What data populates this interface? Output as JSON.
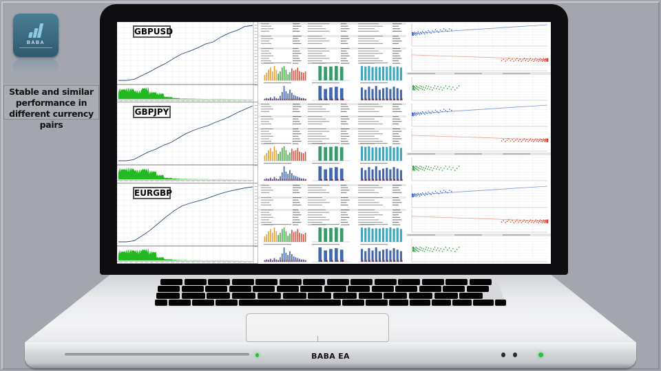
{
  "branding": {
    "logo_text": "BABA",
    "tagline": "Stable and similar performance in different currency pairs",
    "laptop_label": "BABA EA"
  },
  "colors": {
    "background": "#a3a6ae",
    "logo_bg": "#3b6a82",
    "equity_line": "#2c4a7a",
    "deposit_load": "#22b922",
    "bar_orange": "#e8a43a",
    "bar_green": "#4daa4d",
    "bar_red": "#d2594a",
    "bar_teal_green": "#3a9a6a",
    "bar_cyan": "#3aa7c0",
    "bar_blue": "#4466aa",
    "bar_darkred": "#9a2a2a",
    "scatter_blue": "#3b63c4",
    "scatter_red": "#d63a1e",
    "scatter_green": "#1e9a2a",
    "led_green": "#2cbf4a"
  },
  "reports": [
    {
      "pair": "GBPUSD",
      "equity_curve": [
        0,
        0,
        0.02,
        0.09,
        0.16,
        0.24,
        0.31,
        0.4,
        0.48,
        0.53,
        0.59,
        0.66,
        0.7,
        0.79,
        0.86,
        0.91,
        0.98,
        1.0
      ],
      "deposit_load": [
        0.85,
        0.9,
        0.7,
        0.95,
        0.6,
        0.5,
        0.2,
        0.1,
        0.05,
        0.04,
        0.03,
        0.02,
        0.02,
        0.02
      ]
    },
    {
      "pair": "GBPJPY",
      "equity_curve": [
        0,
        0,
        0.02,
        0.09,
        0.16,
        0.21,
        0.28,
        0.33,
        0.41,
        0.49,
        0.55,
        0.6,
        0.64,
        0.7,
        0.75,
        0.81,
        0.88,
        0.94,
        1.0
      ],
      "deposit_load": [
        0.9,
        0.95,
        0.8,
        0.9,
        0.7,
        0.4,
        0.15,
        0.08,
        0.05,
        0.04,
        0.03,
        0.03,
        0.02,
        0.02
      ]
    },
    {
      "pair": "EURGBP",
      "equity_curve": [
        0,
        0,
        0.02,
        0.11,
        0.21,
        0.33,
        0.45,
        0.56,
        0.65,
        0.7,
        0.74,
        0.78,
        0.83,
        0.88,
        0.92,
        0.95,
        0.98,
        1.0
      ],
      "deposit_load": [
        0.8,
        0.9,
        0.85,
        0.95,
        0.75,
        0.3,
        0.12,
        0.06,
        0.04,
        0.03,
        0.03,
        0.02,
        0.02,
        0.02
      ]
    }
  ],
  "hour_bars": [
    0.35,
    0.5,
    0.7,
    0.85,
    0.6,
    0.95,
    0.7,
    0.45,
    0.6,
    0.85,
    0.95,
    0.7,
    0.4,
    0.55,
    0.8,
    0.65,
    0.7,
    0.85,
    0.6,
    0.55,
    0.5,
    0.6
  ],
  "weekday_bars": [
    0.0,
    0.95,
    0.9,
    0.92,
    0.95,
    0.9,
    0.0
  ],
  "month_bars": [
    0.95,
    0.92,
    0.95,
    0.88,
    0.9,
    0.88,
    0.92,
    0.9,
    0.95,
    0.88,
    0.92,
    0.85
  ],
  "hour_profit": [
    0.1,
    0.15,
    0.12,
    0.2,
    0.1,
    0.25,
    0.15,
    0.1,
    0.3,
    0.55,
    0.95,
    0.6,
    0.45,
    0.7,
    0.5,
    0.35,
    0.3,
    0.25,
    0.2,
    0.15,
    0.15,
    0.1
  ],
  "weekday_profit": [
    0.0,
    0.95,
    0.75,
    0.85,
    0.9,
    0.8,
    0.0
  ],
  "month_profit": [
    0.85,
    0.7,
    0.9,
    0.75,
    0.95,
    0.7,
    0.8,
    0.85,
    0.75,
    0.9,
    0.8,
    0.7
  ],
  "mfe_mae_labels": {
    "holding_min": "Minimal position holding time",
    "holding_max": "Maximal position holding time",
    "holding_avg": "Average position holding time"
  }
}
